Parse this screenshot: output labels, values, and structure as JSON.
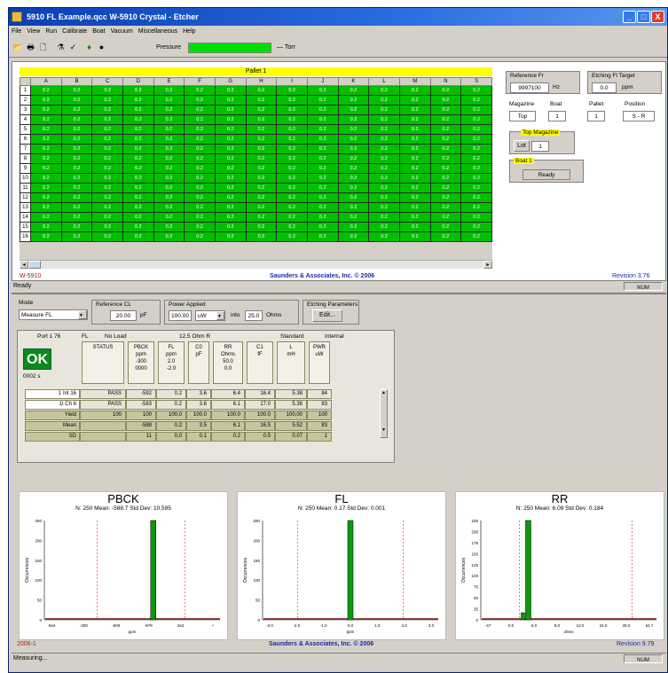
{
  "window": {
    "title": "5910 FL Example.qcc W-5910 Crystal - Etcher",
    "min": "_",
    "max": "□",
    "close": "X"
  },
  "menu": [
    "File",
    "View",
    "Run",
    "Calibrate",
    "Boat",
    "Vacuum",
    "Miscellaneous",
    "Help"
  ],
  "toolbar": {
    "pressure_label": "Pressure",
    "pressure_unit": "Torr"
  },
  "grid": {
    "title": "Pallet 1",
    "columns": [
      "A",
      "B",
      "C",
      "D",
      "E",
      "F",
      "G",
      "H",
      "I",
      "J",
      "K",
      "L",
      "M",
      "N",
      "S"
    ],
    "rows": [
      "1",
      "2",
      "3",
      "4",
      "5",
      "6",
      "7",
      "8",
      "9",
      "10",
      "11",
      "12",
      "13",
      "14",
      "15",
      "16"
    ],
    "cell_value": "0.2"
  },
  "side": {
    "ref_label": "Reference Fr",
    "ref_value": "9997100",
    "ref_unit": "Hz",
    "etch_label": "Etching Fl Target",
    "etch_value": "0.0",
    "etch_unit": "ppm",
    "magazine_label": "Magazine",
    "magazine_value": "Top",
    "boat_label": "Boat",
    "boat_value": "1",
    "pallet_label": "Pallet",
    "pallet_value": "1",
    "position_label": "Position",
    "position_value": "S - R",
    "topmag_label": "Top Magazine",
    "lot_button": "Lot",
    "lot_value": "1",
    "boat1_label": "Boat 1",
    "boat1_status": "Ready"
  },
  "top_footer": {
    "left": "W-5910",
    "center": "Saunders & Associates, Inc. © 2006",
    "right": "Revision 3.76"
  },
  "status1": {
    "text": "Ready",
    "right": "NUM"
  },
  "controls": {
    "mode_label": "Mode",
    "mode_value": "Measure FL",
    "refcl_label": "Reference CL",
    "refcl_value": "20.00",
    "refcl_unit": "pF",
    "power_label": "Power Applied",
    "power_value": "100.00",
    "power_unit": "uW",
    "into_label": "into",
    "ohms_value": "25.0",
    "ohms_unit": "Ohms",
    "etch_params_label": "Etching Parameters",
    "edit_button": "Edit..."
  },
  "measure": {
    "port": "Port 1 76",
    "fl_label": "FL",
    "noload": "No Load",
    "ohm_label": "12.5 Ohm R",
    "standard": "Standard",
    "internal": "Internal",
    "ok": "OK",
    "code": "0002 s",
    "headers": [
      [
        "STATUS"
      ],
      [
        "PBCK",
        "ppm",
        "-300",
        "0000"
      ],
      [
        "FL",
        "ppm",
        "2.0",
        "-2.0"
      ],
      [
        "C0",
        "pF"
      ],
      [
        "RR",
        "Ohms",
        "50.0",
        "0.0"
      ],
      [
        "C1",
        "fF"
      ],
      [
        "L",
        "mH"
      ],
      [
        "PWR",
        "uW"
      ]
    ],
    "rows": [
      {
        "label": "1 Int 16",
        "values": [
          "PASS",
          "-592",
          "0.2",
          "3.6",
          "6.4",
          "16.4",
          "5.38",
          "84"
        ]
      },
      {
        "label": "1t Ch 6",
        "values": [
          "PASS",
          "-583",
          "0.2",
          "3.6",
          "6.1",
          "17.0",
          "5.38",
          "83"
        ]
      },
      {
        "label": "Yield",
        "values": [
          "100",
          "100",
          "100.0",
          "100.0",
          "100.0",
          "100.0",
          "100.00",
          "100"
        ]
      },
      {
        "label": "Mean",
        "values": [
          "",
          "-588",
          "0.2",
          "3.5",
          "6.1",
          "16.5",
          "5.52",
          "83"
        ]
      },
      {
        "label": "SD",
        "values": [
          "",
          "11",
          "0.0",
          "0.1",
          "0.2",
          "0.5",
          "0.07",
          "1"
        ]
      }
    ]
  },
  "chart_data": [
    {
      "type": "bar",
      "title": "PBCK",
      "subtitle": "N: 250   Mean: -588.7   Std Dev: 10.595",
      "ylabel": "Occurrences",
      "xlabel": "ppm",
      "yticks": [
        "250",
        "200",
        "150",
        "100",
        "50",
        "0"
      ],
      "xticks": [
        "-5e4",
        "-300",
        "-600",
        "-879",
        "3e2",
        "+"
      ],
      "peak_x": 0.62,
      "peak_value": 250,
      "ylim": [
        0,
        250
      ]
    },
    {
      "type": "bar",
      "title": "FL",
      "subtitle": "N: 250   Mean: 0.17   Std Dev: 0.001",
      "ylabel": "Occurrences",
      "xlabel": "ppm",
      "yticks": [
        "250",
        "200",
        "150",
        "100",
        "50",
        "0"
      ],
      "xticks": [
        "-3.0",
        "-2.0",
        "-1.0",
        "0.0",
        "1.0",
        "2.0",
        "3.0"
      ],
      "peak_x": 0.5,
      "peak_value": 250,
      "ylim": [
        0,
        250
      ]
    },
    {
      "type": "bar",
      "title": "RR",
      "subtitle": "N: 250   Mean: 6.09   Std Dev: 0.184",
      "ylabel": "Occurrences",
      "xlabel": "ohms",
      "yticks": [
        "225",
        "200",
        "175",
        "150",
        "125",
        "100",
        "75",
        "50",
        "25",
        "0"
      ],
      "xticks": [
        "-47",
        "0.0",
        "6.0",
        "8.0",
        "12.0",
        "24.0",
        "28.0",
        "54.7"
      ],
      "peak_x": 0.27,
      "peak_value": 225,
      "ylim": [
        0,
        225
      ]
    }
  ],
  "bottom_footer": {
    "left": "2006-1",
    "center": "Saunders & Associates, Inc. © 2006",
    "right": "Revision 9.79"
  },
  "status2": {
    "text": "Measuring...",
    "right": "NUM"
  }
}
